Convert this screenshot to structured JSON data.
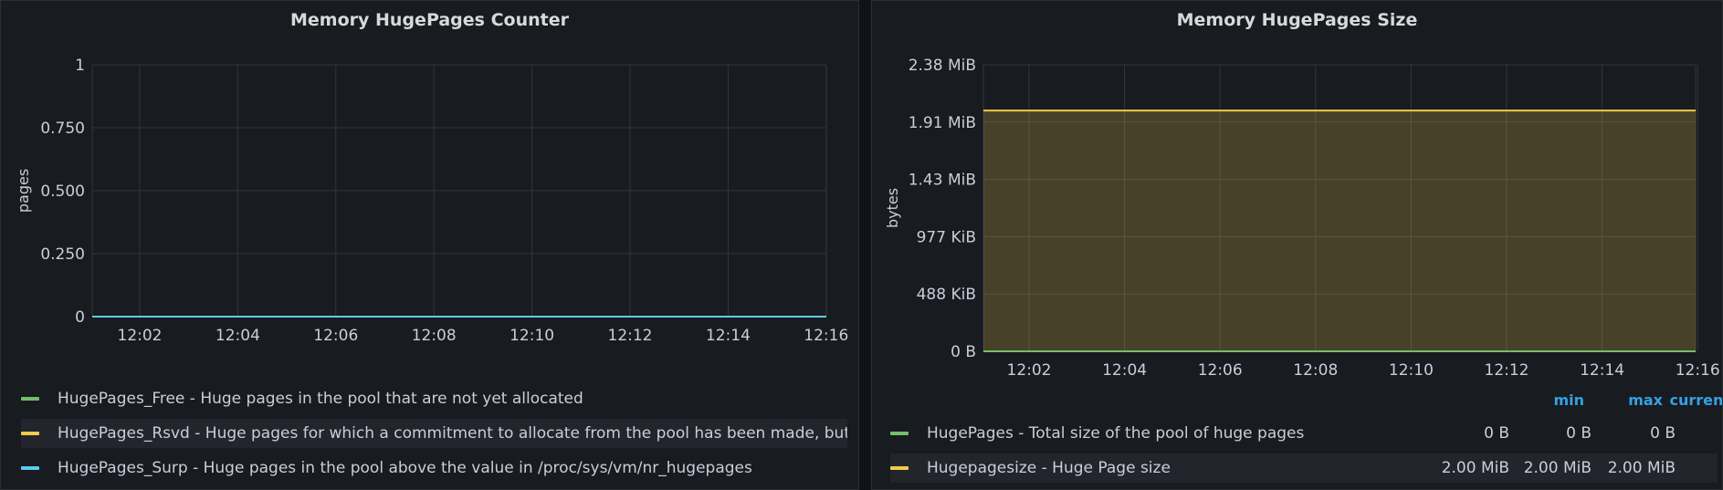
{
  "panels": [
    {
      "title": "Memory HugePages Counter",
      "chart_data": {
        "type": "line",
        "title": "Memory HugePages Counter",
        "ylabel": "pages",
        "x": [
          "12:02",
          "12:04",
          "12:06",
          "12:08",
          "12:10",
          "12:12",
          "12:14",
          "12:16"
        ],
        "y_ticks": [
          "0",
          "0.250",
          "0.500",
          "0.750",
          "1"
        ],
        "ylim": [
          0,
          1
        ],
        "grid": true,
        "series": [
          {
            "name": "HugePages_Free - Huge pages in the pool that are not yet allocated",
            "color": "#73bf69",
            "values": [
              0,
              0,
              0,
              0,
              0,
              0,
              0,
              0
            ]
          },
          {
            "name": "HugePages_Rsvd - Huge pages for which a commitment to allocate from the pool has been made, but no allocation has yet been made",
            "color": "#f2c94c",
            "values": [
              0,
              0,
              0,
              0,
              0,
              0,
              0,
              0
            ]
          },
          {
            "name": "HugePages_Surp - Huge pages in the pool above the value in /proc/sys/vm/nr_hugepages",
            "color": "#5ecbea",
            "values": [
              0,
              0,
              0,
              0,
              0,
              0,
              0,
              0
            ]
          }
        ]
      }
    },
    {
      "title": "Memory HugePages Size",
      "chart_data": {
        "type": "area",
        "title": "Memory HugePages Size",
        "ylabel": "bytes",
        "x": [
          "12:02",
          "12:04",
          "12:06",
          "12:08",
          "12:10",
          "12:12",
          "12:14",
          "12:16"
        ],
        "y_ticks": [
          "0 B",
          "488 KiB",
          "977 KiB",
          "1.43 MiB",
          "1.91 MiB",
          "2.38 MiB"
        ],
        "ylim_mib": [
          0,
          2.38
        ],
        "grid": true,
        "legend_columns": [
          "min",
          "max",
          "current"
        ],
        "series": [
          {
            "name": "HugePages - Total size of the pool of huge pages",
            "color": "#73bf69",
            "value_mib": 0,
            "stats": [
              "0 B",
              "0 B",
              "0 B"
            ]
          },
          {
            "name": "Hugepagesize - Huge Page size",
            "color": "#f2c94c",
            "value_mib": 2.0,
            "stats": [
              "2.00 MiB",
              "2.00 MiB",
              "2.00 MiB"
            ]
          }
        ]
      }
    }
  ]
}
